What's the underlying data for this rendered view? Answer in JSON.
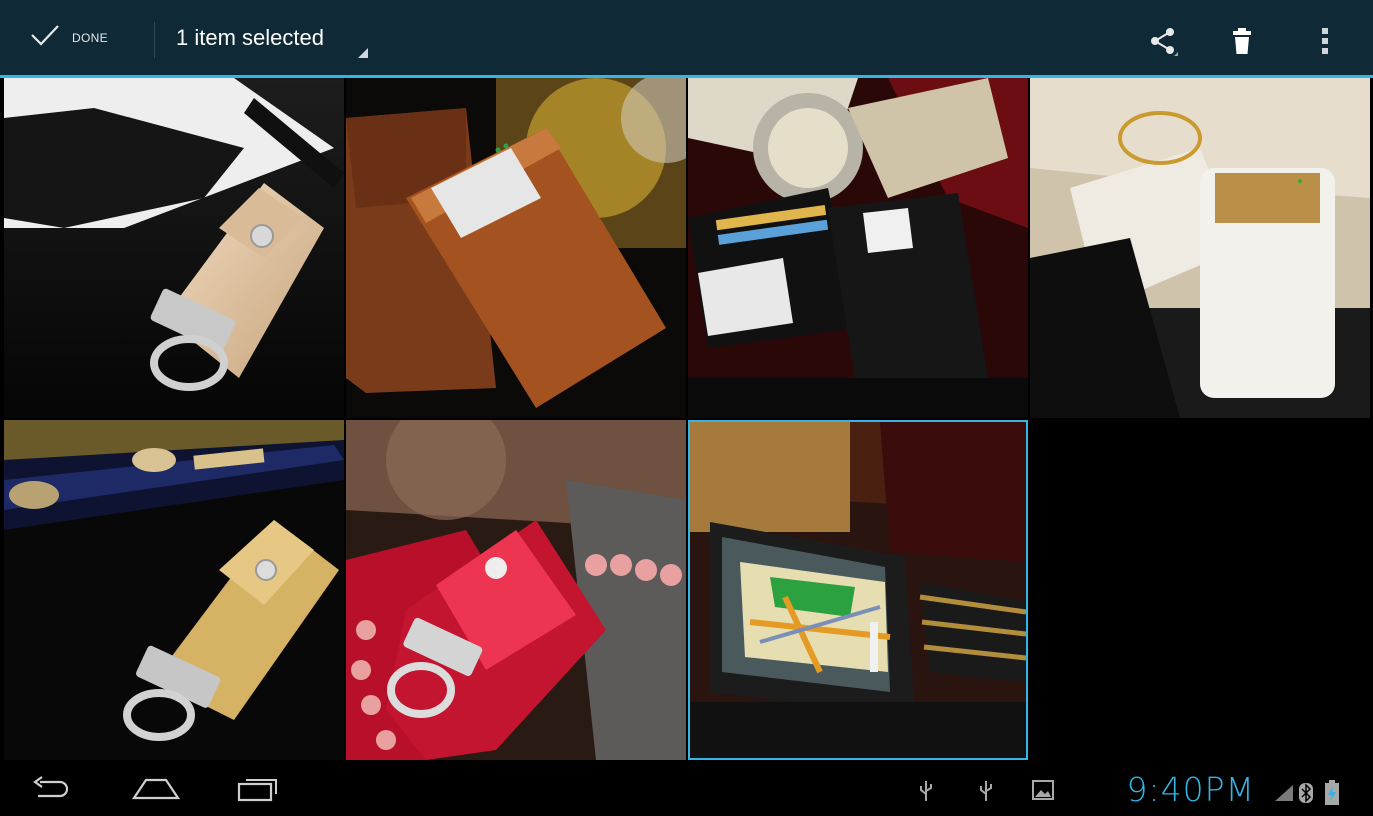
{
  "actionbar": {
    "done_label": "DONE",
    "selection_title": "1 item selected",
    "accent": "#33b5e5",
    "icons": [
      "check-icon",
      "share-icon",
      "trash-icon",
      "overflow-menu-icon"
    ]
  },
  "gallery": {
    "items": [
      {
        "name": "photo-usb-drive-cream-leather",
        "selected": false
      },
      {
        "name": "photo-brown-leather-case",
        "selected": false
      },
      {
        "name": "photo-black-wallet",
        "selected": false
      },
      {
        "name": "photo-white-device-gold-plate",
        "selected": false
      },
      {
        "name": "photo-usb-drive-gold-leather",
        "selected": false
      },
      {
        "name": "photo-usb-drive-red-leather",
        "selected": false
      },
      {
        "name": "photo-gps-navigator",
        "selected": true
      }
    ]
  },
  "navbar": {
    "icons": [
      "back-icon",
      "home-icon",
      "recent-apps-icon"
    ]
  },
  "statusbar": {
    "time": "9:40PM",
    "time_color": "#33b5e5",
    "icons": [
      "usb-icon",
      "usb-icon",
      "gallery-notification-icon",
      "signal-icon",
      "bluetooth-icon",
      "battery-charging-icon"
    ]
  }
}
